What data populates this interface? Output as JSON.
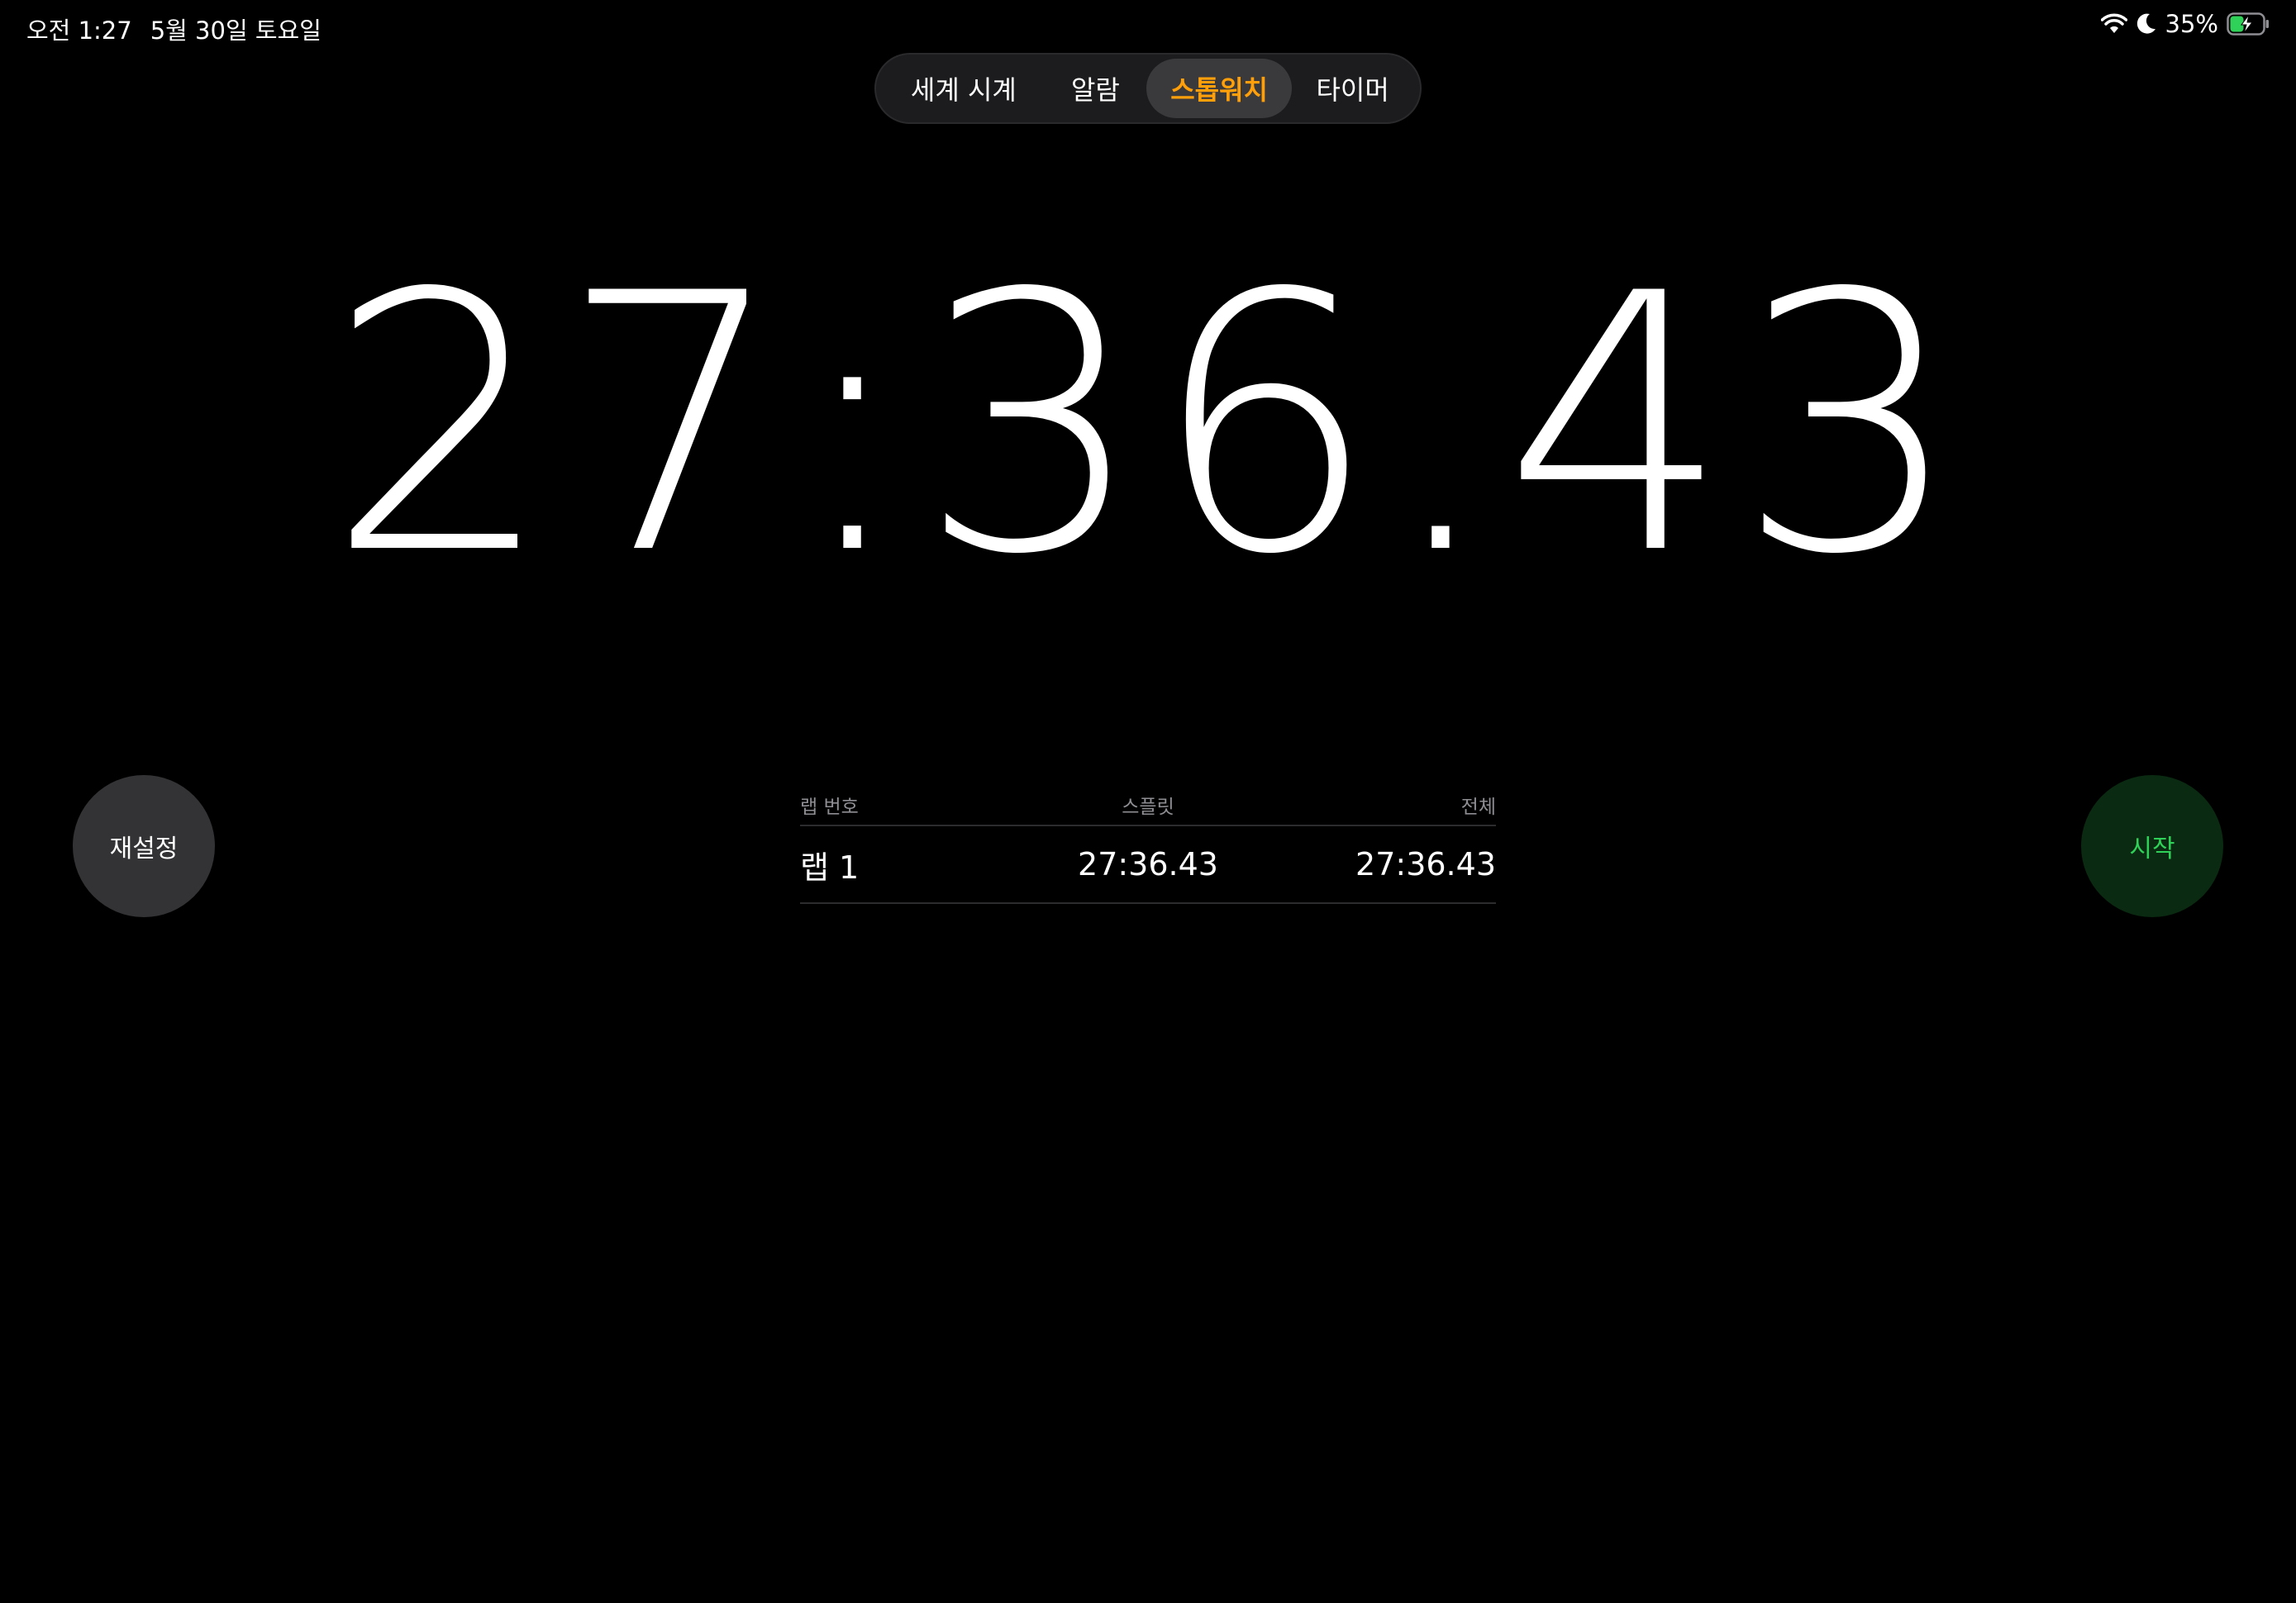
{
  "status_bar": {
    "time": "오전 1:27",
    "date": "5월 30일 토요일",
    "battery": "35%",
    "icons": [
      "wifi-icon",
      "moon-icon",
      "battery-charging-icon"
    ]
  },
  "tabs": [
    {
      "label": "세계 시계",
      "active": false
    },
    {
      "label": "알람",
      "active": false
    },
    {
      "label": "스톱워치",
      "active": true
    },
    {
      "label": "타이머",
      "active": false
    }
  ],
  "stopwatch": {
    "display": "27:36.43"
  },
  "buttons": {
    "reset_label": "재설정",
    "start_label": "시작"
  },
  "lap_table": {
    "headers": {
      "lap": "랩 번호",
      "split": "스플릿",
      "total": "전체"
    },
    "rows": [
      {
        "lap": "랩 1",
        "split": "27:36.43",
        "total": "27:36.43"
      }
    ]
  },
  "colors": {
    "background": "#000000",
    "accent_active_tab": "#ff9f0a",
    "start_text": "#30d158",
    "start_bg": "#0a2a12",
    "reset_bg": "#333335"
  }
}
